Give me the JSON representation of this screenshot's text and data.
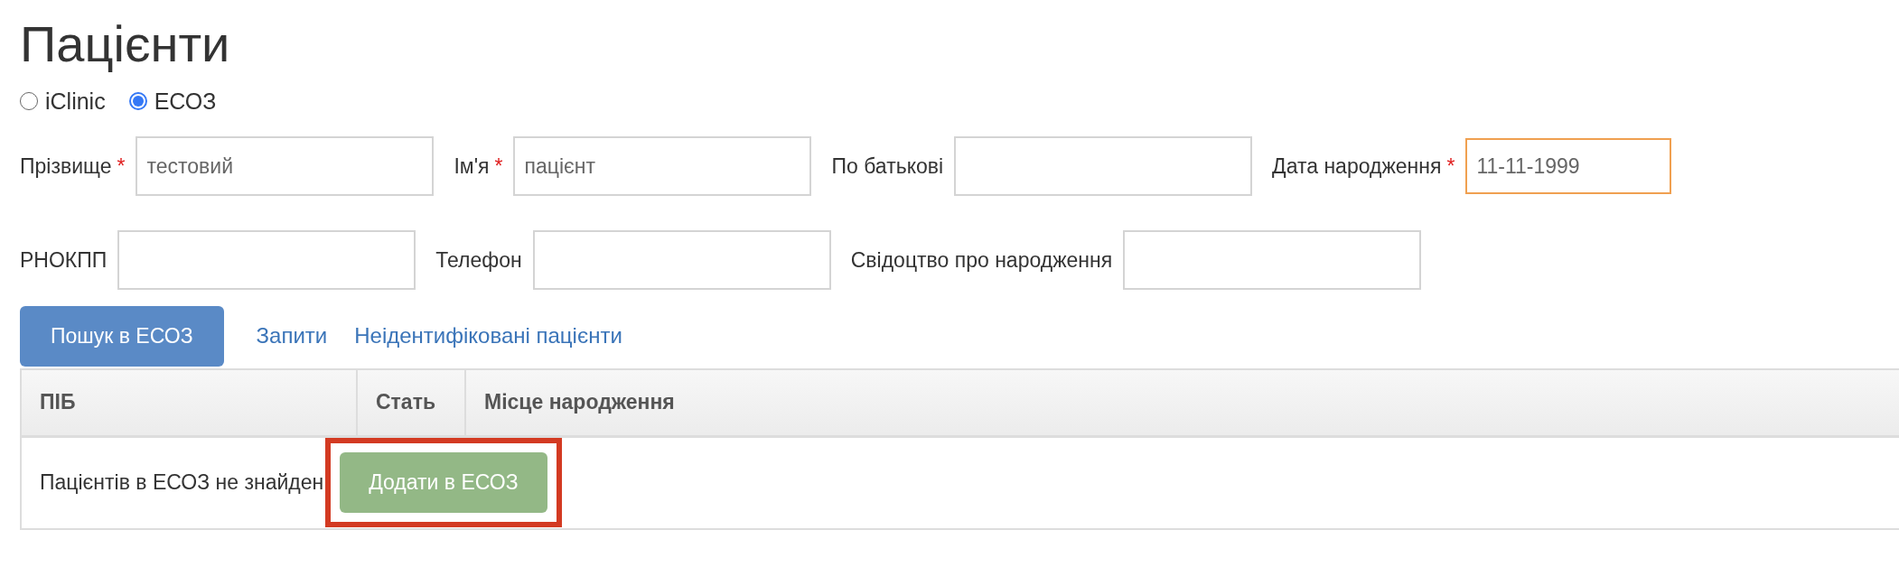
{
  "title": "Пацієнти",
  "sources": [
    {
      "label": "iClinic",
      "selected": false
    },
    {
      "label": "ЕСОЗ",
      "selected": true
    }
  ],
  "field_rows": [
    [
      {
        "label": "Прізвище",
        "required": true,
        "value": "тестовий",
        "focused": false
      },
      {
        "label": "Ім'я",
        "required": true,
        "value": "пацієнт",
        "focused": false
      },
      {
        "label": "По батькові",
        "required": false,
        "focused": false
      },
      {
        "label": "Дата народження",
        "required": true,
        "value": "11-11-1999",
        "focused": true
      }
    ],
    [
      {
        "label": "РНОКПП",
        "required": false,
        "focused": false
      },
      {
        "label": "Телефон",
        "required": false,
        "focused": false
      },
      {
        "label": "Свідоцтво про народження",
        "required": false,
        "focused": false
      }
    ]
  ],
  "required_mark": "*",
  "search_button": "Пошук в ЕСОЗ",
  "links": [
    "Запити",
    "Неідентифіковані пацієнти"
  ],
  "table": {
    "columns": [
      "ПІБ",
      "Стать",
      "Місце народження"
    ],
    "empty_message": "Пацієнтів в ЕСОЗ не знайден",
    "add_button": {
      "label": "Додати в ЕСОЗ",
      "highlighted": true
    }
  }
}
